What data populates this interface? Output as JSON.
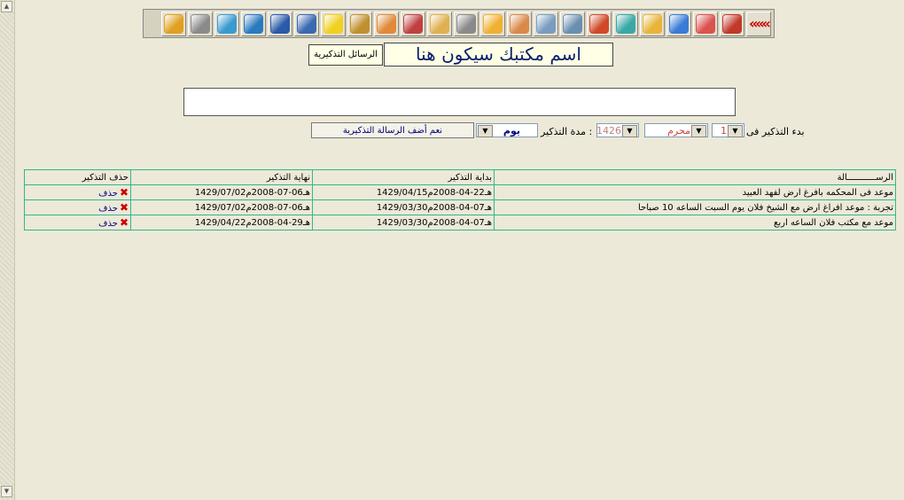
{
  "toolbar": {
    "back_label": "«««",
    "icons": [
      {
        "name": "home-icon",
        "color": "#c0392b"
      },
      {
        "name": "folder-red-icon",
        "color": "#d9534f"
      },
      {
        "name": "folder-blue-icon",
        "color": "#3a7bd5"
      },
      {
        "name": "folder-yellow-icon",
        "color": "#e8b43a"
      },
      {
        "name": "folder-teal-icon",
        "color": "#3aa8a8"
      },
      {
        "name": "cubes-icon",
        "color": "#d04a2a"
      },
      {
        "name": "drive-arrow-icon",
        "color": "#6a8fb0"
      },
      {
        "name": "drive-icon",
        "color": "#7a9cc0"
      },
      {
        "name": "document-pen-icon",
        "color": "#d98a4a"
      },
      {
        "name": "weather-icon",
        "color": "#f0b030"
      },
      {
        "name": "tools-icon",
        "color": "#8a8a8a"
      },
      {
        "name": "clipboard-icon",
        "color": "#e0b050"
      },
      {
        "name": "edit-note-icon",
        "color": "#c04040"
      },
      {
        "name": "users-icon",
        "color": "#e08a3a"
      },
      {
        "name": "refresh-doc-icon",
        "color": "#c09030"
      },
      {
        "name": "sticky-note-icon",
        "color": "#f0d020"
      },
      {
        "name": "save-arrow-icon",
        "color": "#3a6ab0"
      },
      {
        "name": "floppy-icon",
        "color": "#2a5aa8"
      },
      {
        "name": "globe-icon",
        "color": "#2a7ac0"
      },
      {
        "name": "package-icon",
        "color": "#3a9ad0"
      },
      {
        "name": "printer-icon",
        "color": "#8a8a8a"
      },
      {
        "name": "lock-icon",
        "color": "#e0a020"
      }
    ]
  },
  "header": {
    "office_name": "اسم مكتبك سيكون هنا",
    "reminders_button": "الرسائل التذكيرية"
  },
  "form": {
    "start_label": "بدء التذكير فى",
    "day_value": "1",
    "month_value": "محرم",
    "year_value": "1426",
    "duration_label": "مدة التذكير :",
    "unit_value": "يوم",
    "add_button": "نعم أضف الرسالة التذكيرية"
  },
  "table": {
    "headers": [
      "الرســـــــــــالة",
      "بداية التذكير",
      "نهاية التذكير",
      "حذف التذكير"
    ],
    "rows": [
      {
        "message": "موعد فى المحكمه بافرغ ارض لفهد العبيد",
        "start": "1429/04/15هـ22-04-2008م",
        "end": "1429/07/02هـ06-07-2008م",
        "delete": "حذف"
      },
      {
        "message": "تجربة : موعد افراغ ارض مع الشيخ فلان يوم السبت الساعه 10 صباحا",
        "start": "1429/03/30هـ07-04-2008م",
        "end": "1429/07/02هـ06-07-2008م",
        "delete": "حذف"
      },
      {
        "message": "موعد مع مكتب فلان الساعه اربع",
        "start": "1429/03/30هـ07-04-2008م",
        "end": "1429/04/22هـ29-04-2008م",
        "delete": "حذف"
      }
    ]
  }
}
